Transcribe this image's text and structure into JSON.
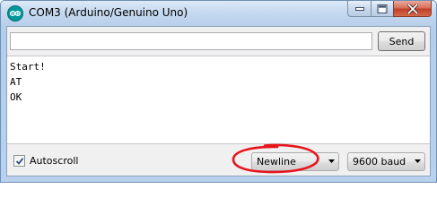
{
  "window": {
    "title": "COM3 (Arduino/Genuino Uno)"
  },
  "send": {
    "input_value": "",
    "button_label": "Send"
  },
  "output": {
    "lines": [
      "Start!",
      "AT",
      "OK"
    ]
  },
  "footer": {
    "autoscroll_label": "Autoscroll",
    "autoscroll_checked": true,
    "line_ending": "Newline",
    "baud_rate": "9600 baud"
  },
  "colors": {
    "annotation": "#e8141c",
    "arduino_teal": "#00979c"
  },
  "icons": {
    "app": "arduino-logo-icon",
    "minimize": "minimize-icon",
    "maximize": "maximize-icon",
    "close": "close-icon",
    "check": "checkmark-icon",
    "dropdown": "chevron-down-icon"
  }
}
